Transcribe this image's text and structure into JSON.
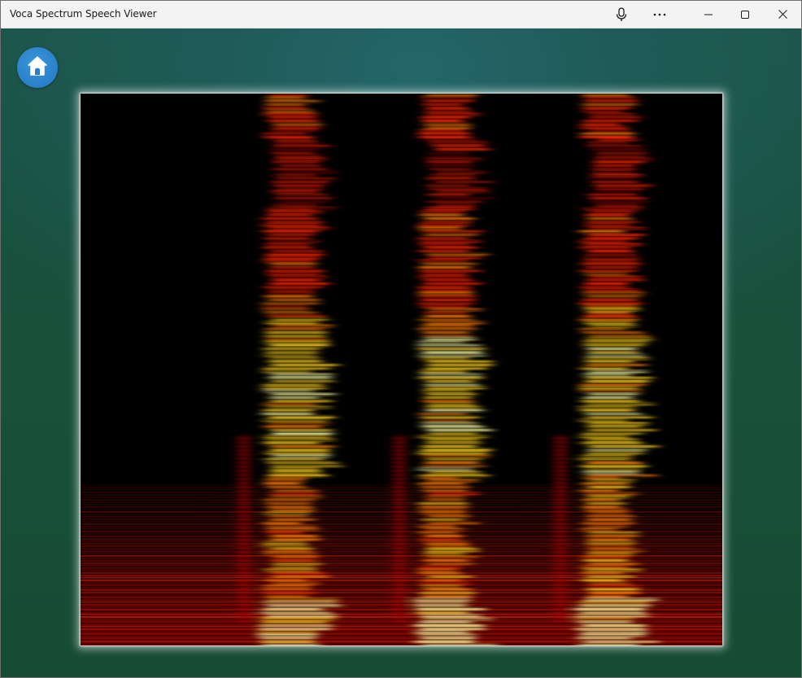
{
  "window": {
    "title": "Voca Spectrum Speech Viewer"
  },
  "titlebar": {
    "buttons": [
      {
        "name": "microphone-icon"
      },
      {
        "name": "more-options-icon"
      },
      {
        "name": "minimize-icon"
      },
      {
        "name": "maximize-icon"
      },
      {
        "name": "close-icon"
      }
    ]
  },
  "toolbar": {
    "home_icon": "home-icon"
  },
  "spectrogram": {
    "colormap": [
      "#000000",
      "#5a0000",
      "#b00a00",
      "#ff2200",
      "#ff7a00",
      "#ffd21a",
      "#ffffa0"
    ],
    "background": "#000000",
    "utterance_count": 3
  }
}
